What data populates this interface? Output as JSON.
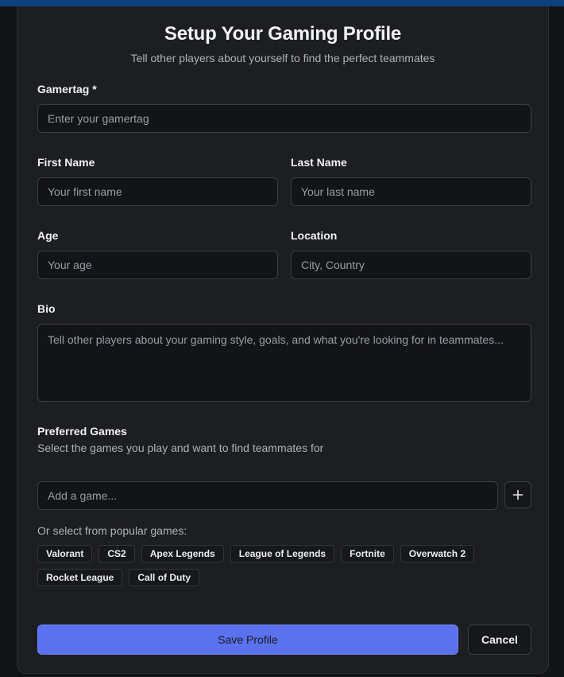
{
  "header": {
    "title": "Setup Your Gaming Profile",
    "subtitle": "Tell other players about yourself to find the perfect teammates"
  },
  "form": {
    "gamertag": {
      "label": "Gamertag *",
      "placeholder": "Enter your gamertag",
      "value": ""
    },
    "first_name": {
      "label": "First Name",
      "placeholder": "Your first name",
      "value": ""
    },
    "last_name": {
      "label": "Last Name",
      "placeholder": "Your last name",
      "value": ""
    },
    "age": {
      "label": "Age",
      "placeholder": "Your age",
      "value": ""
    },
    "location": {
      "label": "Location",
      "placeholder": "City, Country",
      "value": ""
    },
    "bio": {
      "label": "Bio",
      "placeholder": "Tell other players about your gaming style, goals, and what you're looking for in teammates...",
      "value": ""
    }
  },
  "games": {
    "heading": "Preferred Games",
    "description": "Select the games you play and want to find teammates for",
    "add_placeholder": "Add a game...",
    "add_icon": "plus-icon",
    "popular_label": "Or select from popular games:",
    "popular": [
      "Valorant",
      "CS2",
      "Apex Legends",
      "League of Legends",
      "Fortnite",
      "Overwatch 2",
      "Rocket League",
      "Call of Duty"
    ]
  },
  "actions": {
    "save_label": "Save Profile",
    "cancel_label": "Cancel"
  },
  "colors": {
    "background": "#121316",
    "card": "#1d1e22",
    "accent": "#5a72ee",
    "top_bar": "#0f3f7f"
  }
}
